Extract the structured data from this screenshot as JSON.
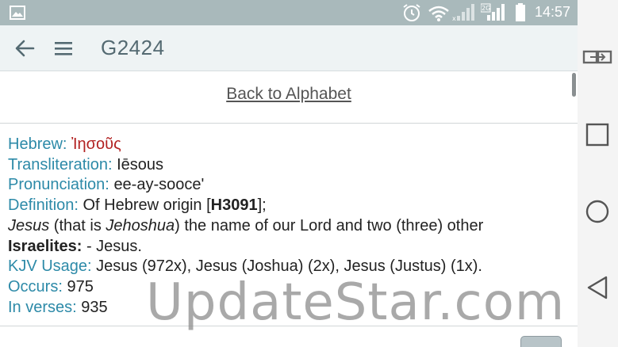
{
  "status_bar": {
    "time": "14:57",
    "icons": [
      "image-icon",
      "alarm-icon",
      "wifi-icon",
      "signal-icon",
      "signal-2g-icon",
      "battery-icon"
    ]
  },
  "app_bar": {
    "title": "G2424"
  },
  "back_link": "Back to Alphabet",
  "entry": {
    "hebrew_label": "Hebrew:",
    "hebrew_value": "Ἰησοῦς",
    "translit_label": "Transliteration:",
    "translit_value": "Iēsous",
    "pron_label": "Pronunciation:",
    "pron_value": "ee-ay-sooce'",
    "def_label": "Definition:",
    "def_pre": "Of Hebrew origin [",
    "def_ref": "H3091",
    "def_post": "];",
    "def_line2_jesus": "Jesus",
    "def_line2_mid": " (that is ",
    "def_line2_jehoshua": "Jehoshua",
    "def_line2_rest": ") the name of our Lord and two (three) other",
    "def_line3_bold": "Israelites:",
    "def_line3_rest": " - Jesus.",
    "kjv_label": "KJV Usage:",
    "kjv_value": "Jesus (972x), Jesus (Joshua) (2x), Jesus (Justus) (1x).",
    "occurs_label": "Occurs:",
    "occurs_value": "975",
    "verses_label": "In verses:",
    "verses_value": "935"
  },
  "watermark": "UpdateStar.com",
  "colors": {
    "label": "#2d8aa8",
    "greek": "#b22222",
    "status_bar": "#a9b9bb",
    "app_bar": "#eef3f4"
  }
}
